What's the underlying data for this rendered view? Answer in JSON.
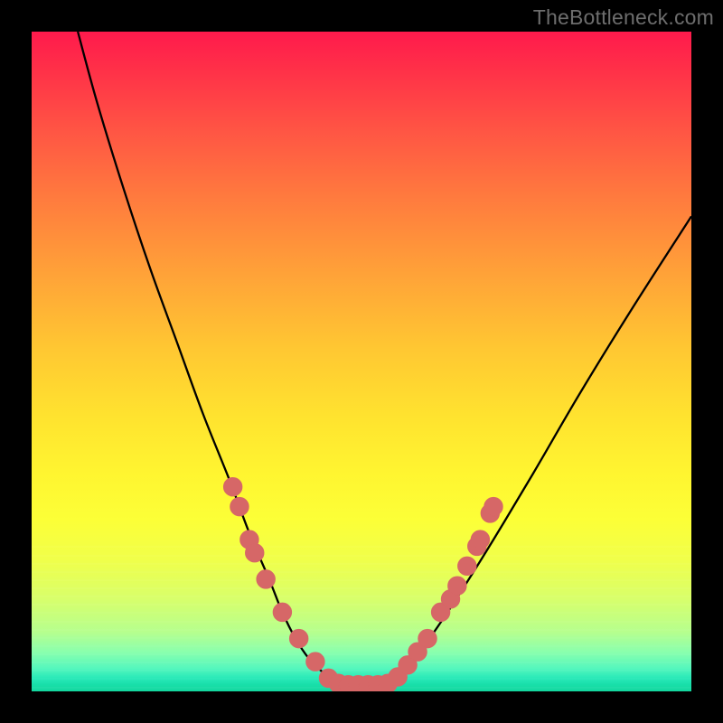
{
  "watermark": "TheBottleneck.com",
  "colors": {
    "background": "#000000",
    "curve": "#000000",
    "marker_fill": "#d66767",
    "marker_stroke": "#d66767",
    "gradient_top": "#ff1a4c",
    "gradient_bottom": "#14d89f"
  },
  "chart_data": {
    "type": "line",
    "title": "",
    "xlabel": "",
    "ylabel": "",
    "xlim": [
      0,
      100
    ],
    "ylim": [
      0,
      100
    ],
    "grid": false,
    "legend": false,
    "series": [
      {
        "name": "left-curve",
        "x": [
          7,
          10,
          14,
          18,
          22,
          26,
          30,
          33,
          36,
          38,
          40,
          42,
          44,
          45.5,
          47
        ],
        "y": [
          100,
          89,
          76,
          64,
          53,
          42,
          32,
          24,
          17,
          12,
          8,
          5,
          3,
          1.6,
          1
        ]
      },
      {
        "name": "right-curve",
        "x": [
          54,
          56,
          58,
          61,
          65,
          70,
          76,
          83,
          91,
          100
        ],
        "y": [
          1,
          2.5,
          5,
          9,
          15,
          23,
          33,
          45,
          58,
          72
        ]
      },
      {
        "name": "valley-floor",
        "x": [
          47,
          48.5,
          50,
          51.5,
          53,
          54
        ],
        "y": [
          1,
          0.8,
          0.8,
          0.8,
          0.9,
          1
        ]
      }
    ],
    "markers": [
      {
        "x": 30.5,
        "y": 31
      },
      {
        "x": 31.5,
        "y": 28
      },
      {
        "x": 33.0,
        "y": 23
      },
      {
        "x": 33.8,
        "y": 21
      },
      {
        "x": 35.5,
        "y": 17
      },
      {
        "x": 38.0,
        "y": 12
      },
      {
        "x": 40.5,
        "y": 8
      },
      {
        "x": 43.0,
        "y": 4.5
      },
      {
        "x": 45.0,
        "y": 2
      },
      {
        "x": 46.5,
        "y": 1.2
      },
      {
        "x": 48.0,
        "y": 1
      },
      {
        "x": 49.5,
        "y": 1
      },
      {
        "x": 51.0,
        "y": 1
      },
      {
        "x": 52.5,
        "y": 1
      },
      {
        "x": 54.0,
        "y": 1.2
      },
      {
        "x": 55.5,
        "y": 2.2
      },
      {
        "x": 57.0,
        "y": 4
      },
      {
        "x": 58.5,
        "y": 6
      },
      {
        "x": 60.0,
        "y": 8
      },
      {
        "x": 62.0,
        "y": 12
      },
      {
        "x": 63.5,
        "y": 14
      },
      {
        "x": 64.5,
        "y": 16
      },
      {
        "x": 66.0,
        "y": 19
      },
      {
        "x": 67.5,
        "y": 22
      },
      {
        "x": 68.0,
        "y": 23
      },
      {
        "x": 69.5,
        "y": 27
      },
      {
        "x": 70.0,
        "y": 28
      }
    ],
    "marker_radius": 1.4
  }
}
